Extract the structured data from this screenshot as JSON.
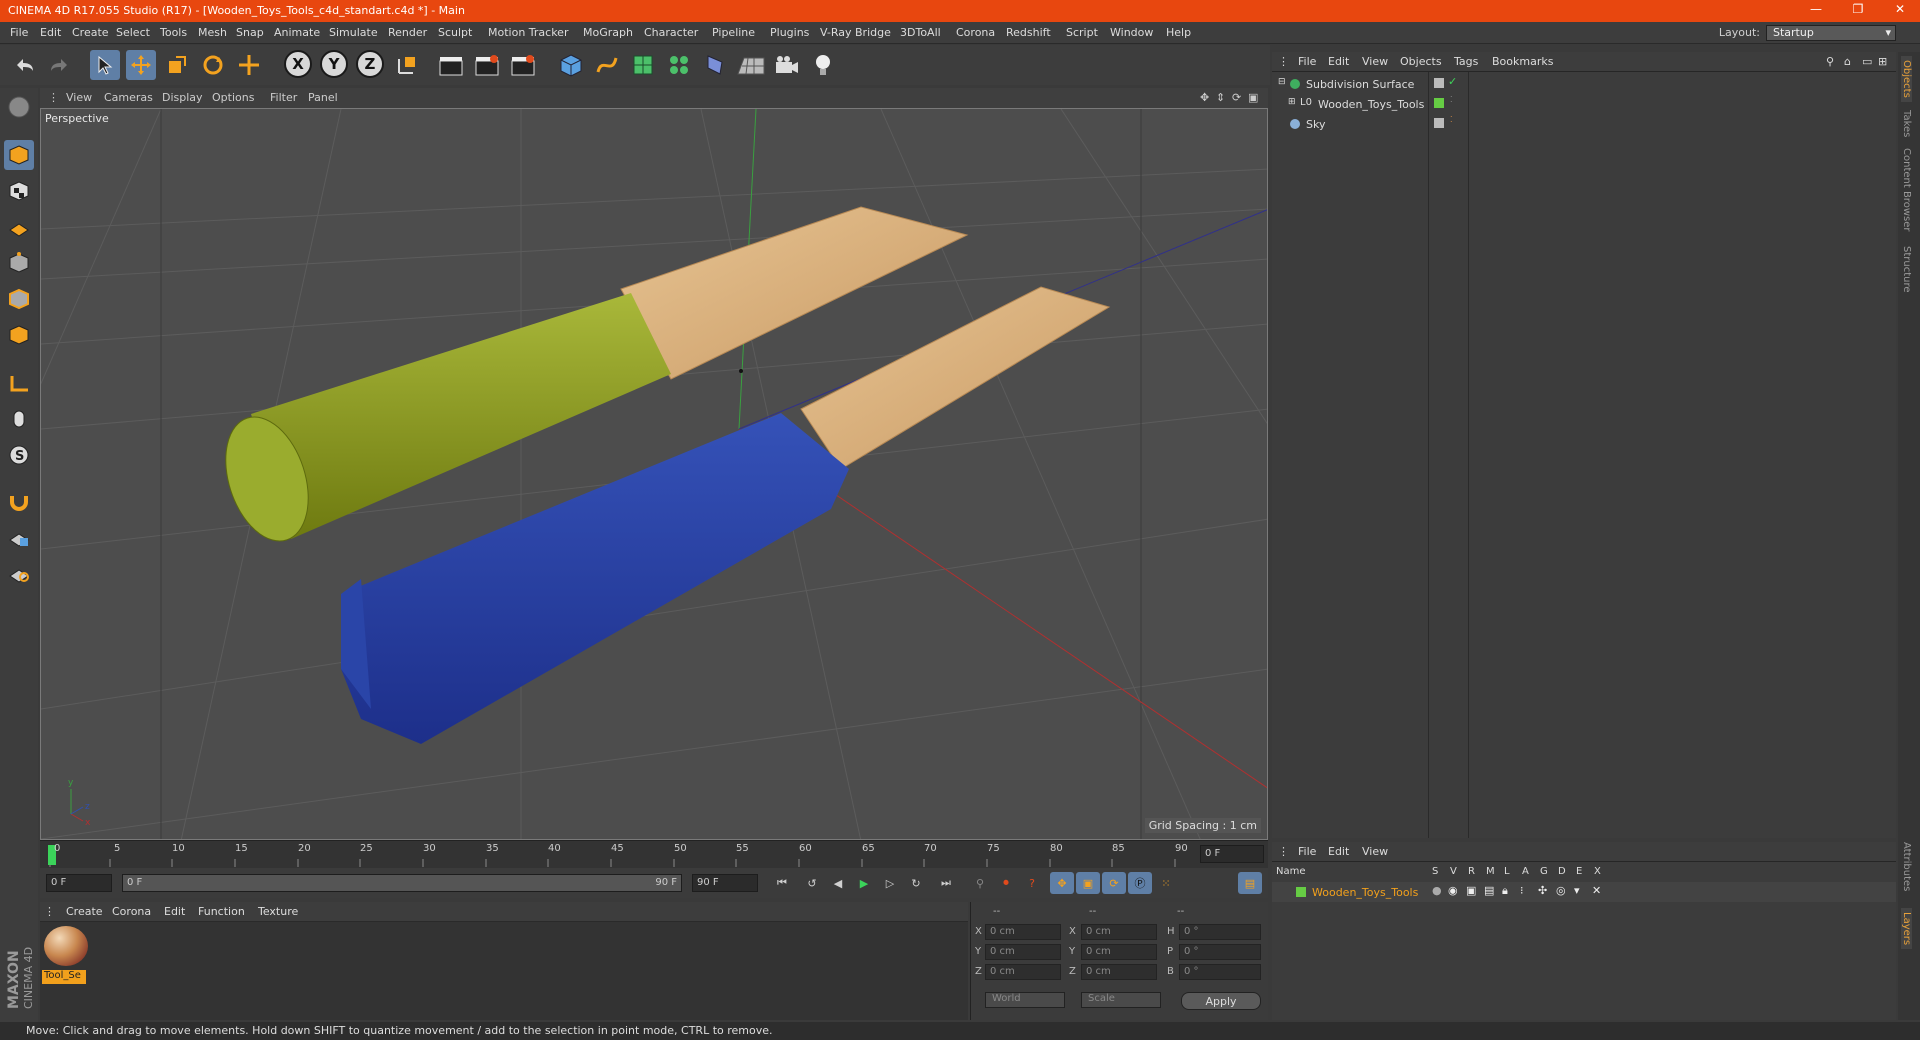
{
  "window": {
    "title": "CINEMA 4D R17.055 Studio (R17) - [Wooden_Toys_Tools_c4d_standart.c4d *] - Main",
    "controls": [
      "—",
      "❐",
      "✕"
    ]
  },
  "menubar": {
    "items": [
      "File",
      "Edit",
      "Create",
      "Select",
      "Tools",
      "Mesh",
      "Snap",
      "Animate",
      "Simulate",
      "Render",
      "Sculpt",
      "Motion Tracker",
      "MoGraph",
      "Character",
      "Pipeline",
      "Plugins",
      "V-Ray Bridge",
      "3DToAll",
      "Corona",
      "Redshift",
      "Script",
      "Window",
      "Help"
    ],
    "layout_label": "Layout:",
    "layout_value": "Startup"
  },
  "toolbar": {
    "axis_x": "X",
    "axis_y": "Y",
    "axis_z": "Z"
  },
  "viewport": {
    "menu": [
      "View",
      "Cameras",
      "Display",
      "Options",
      "Filter",
      "Panel"
    ],
    "label": "Perspective",
    "grid_spacing": "Grid Spacing : 1 cm"
  },
  "timeline": {
    "ticks": [
      "0",
      "5",
      "10",
      "15",
      "20",
      "25",
      "30",
      "35",
      "40",
      "45",
      "50",
      "55",
      "60",
      "65",
      "70",
      "75",
      "80",
      "85",
      "90"
    ],
    "end_field": "0 F",
    "start_frame": "0 F",
    "range_start": "0 F",
    "range_end": "90 F",
    "max_frame": "90 F"
  },
  "materials": {
    "menu": [
      "Create",
      "Corona",
      "Edit",
      "Function",
      "Texture"
    ],
    "items": [
      {
        "label": "Tool_Se"
      }
    ]
  },
  "coords": {
    "headers": [
      "--",
      "--",
      "--"
    ],
    "rows": [
      {
        "a": "X",
        "av": "0 cm",
        "b": "X",
        "bv": "0 cm",
        "c": "H",
        "cv": "0 °"
      },
      {
        "a": "Y",
        "av": "0 cm",
        "b": "Y",
        "bv": "0 cm",
        "c": "P",
        "cv": "0 °"
      },
      {
        "a": "Z",
        "av": "0 cm",
        "b": "Z",
        "bv": "0 cm",
        "c": "B",
        "cv": "0 °"
      }
    ],
    "mode1": "World",
    "mode2": "Scale",
    "apply": "Apply"
  },
  "objects": {
    "menu": [
      "File",
      "Edit",
      "View",
      "Objects",
      "Tags",
      "Bookmarks"
    ],
    "items": [
      {
        "name": "Subdivision Surface"
      },
      {
        "name": "Wooden_Toys_Tools"
      },
      {
        "name": "Sky"
      }
    ]
  },
  "layers": {
    "menu": [
      "File",
      "Edit",
      "View"
    ],
    "headers": [
      "Name",
      "S",
      "V",
      "R",
      "M",
      "L",
      "A",
      "G",
      "D",
      "E",
      "X"
    ],
    "items": [
      {
        "name": "Wooden_Toys_Tools"
      }
    ]
  },
  "right_tabs": [
    "Objects",
    "Takes",
    "Content Browser",
    "Structure",
    "Attributes",
    "Layers"
  ],
  "status": "Move: Click and drag to move elements. Hold down SHIFT to quantize movement / add to the selection in point mode, CTRL to remove.",
  "brand": {
    "line1": "MAXON",
    "line2": "CINEMA 4D"
  },
  "colors": {
    "title_bar": "#e8470f",
    "selection": "#f2a01c",
    "layer_green": "#66cc44"
  }
}
